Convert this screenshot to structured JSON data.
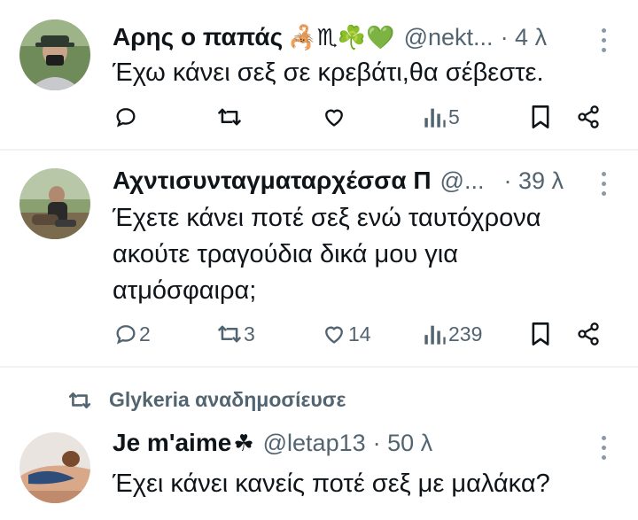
{
  "tweets": [
    {
      "name": "Αρης ο παπάς",
      "emojis": "🦂♏☘️💚",
      "handle": "@nekt...",
      "time": "· 4 λ",
      "text": "Έχω κάνει σεξ σε κρεβάτι,θα σέβεστε.",
      "replies": "",
      "retweets": "",
      "likes": "",
      "views": "5"
    },
    {
      "name": "Αχντισυνταγματαρχέσσα Π",
      "handle": "@...",
      "time": "· 39 λ",
      "text": "Έχετε κάνει ποτέ σεξ ενώ ταυτόχρονα ακούτε τραγούδια δικά μου για ατμόσφαιρα;",
      "replies": "2",
      "retweets": "3",
      "likes": "14",
      "views": "239"
    },
    {
      "retweeted_by": "Glykeria αναδημοσίευσε",
      "name": "Je m'aime",
      "emojis": "☘",
      "handle": "@letap13",
      "time": "· 50 λ",
      "text": "Έχει κάνει κανείς ποτέ σεξ με μαλάκα?"
    }
  ],
  "icons": {
    "reply": "speech-bubble-icon",
    "retweet": "retweet-icon",
    "like": "heart-icon",
    "views": "bar-chart-icon",
    "bookmark": "bookmark-icon",
    "share": "share-icon",
    "more": "more-vertical-icon"
  },
  "colors": {
    "text": "#0f1419",
    "secondary": "#536471",
    "divider": "#eff3f4"
  }
}
